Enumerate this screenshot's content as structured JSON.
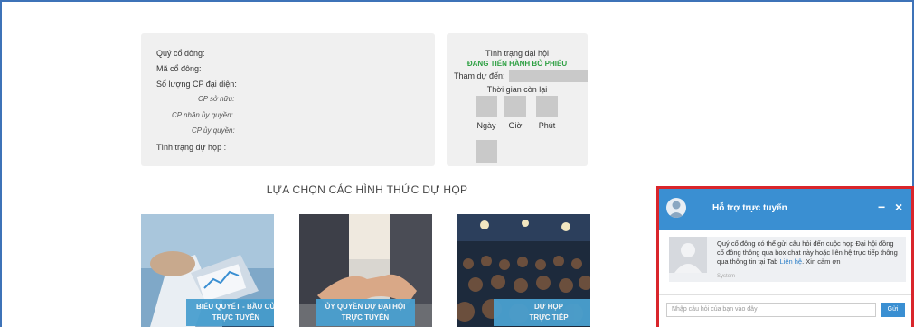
{
  "shareholder_info": {
    "name_label": "Quý cổ đông:",
    "code_label": "Mã cổ đông:",
    "shares_label": "Số lượng CP đại diện:",
    "owned_label": "CP sở hữu:",
    "received_label": "CP nhận ủy quyền:",
    "delegated_label": "CP ủy quyền:",
    "attendance_label": "Tình trạng dự họp :"
  },
  "meeting_status": {
    "title": "Tình trạng đại hội",
    "state": "ĐANG TIẾN HÀNH BỎ PHIẾU",
    "attend_label": "Tham dự đến:",
    "countdown_title": "Thời gian còn lại",
    "day_label": "Ngày",
    "hour_label": "Giờ",
    "minute_label": "Phút"
  },
  "options": {
    "heading": "LỰA CHỌN CÁC HÌNH THỨC DỰ HỌP",
    "cards": [
      {
        "line1": "BIỂU QUYẾT - BẦU CỬ",
        "line2": "TRỰC TUYẾN"
      },
      {
        "line1": "ỦY QUYỀN DỰ ĐẠI HỘI",
        "line2": "TRỰC TUYẾN"
      },
      {
        "line1": "DỰ HỌP",
        "line2": "TRỰC TIẾP"
      }
    ]
  },
  "chat": {
    "title": "Hỗ trợ trực tuyến",
    "minimize": "−",
    "close": "×",
    "message_before": "Quý cổ đông có thể gửi câu hỏi đến cuộc họp Đại hội đồng cổ đông thông qua box chat này hoặc liên hệ trực tiếp thông qua thông tin tại Tab ",
    "message_link": "Liên hệ",
    "message_after": ". Xin cảm ơn",
    "sender": "System",
    "input_placeholder": "Nhập câu hỏi của bạn vào đây",
    "send_label": "Gửi"
  },
  "colors": {
    "accent": "#3a8fd2",
    "status_green": "#2ea043",
    "chat_border": "#d9252b"
  }
}
